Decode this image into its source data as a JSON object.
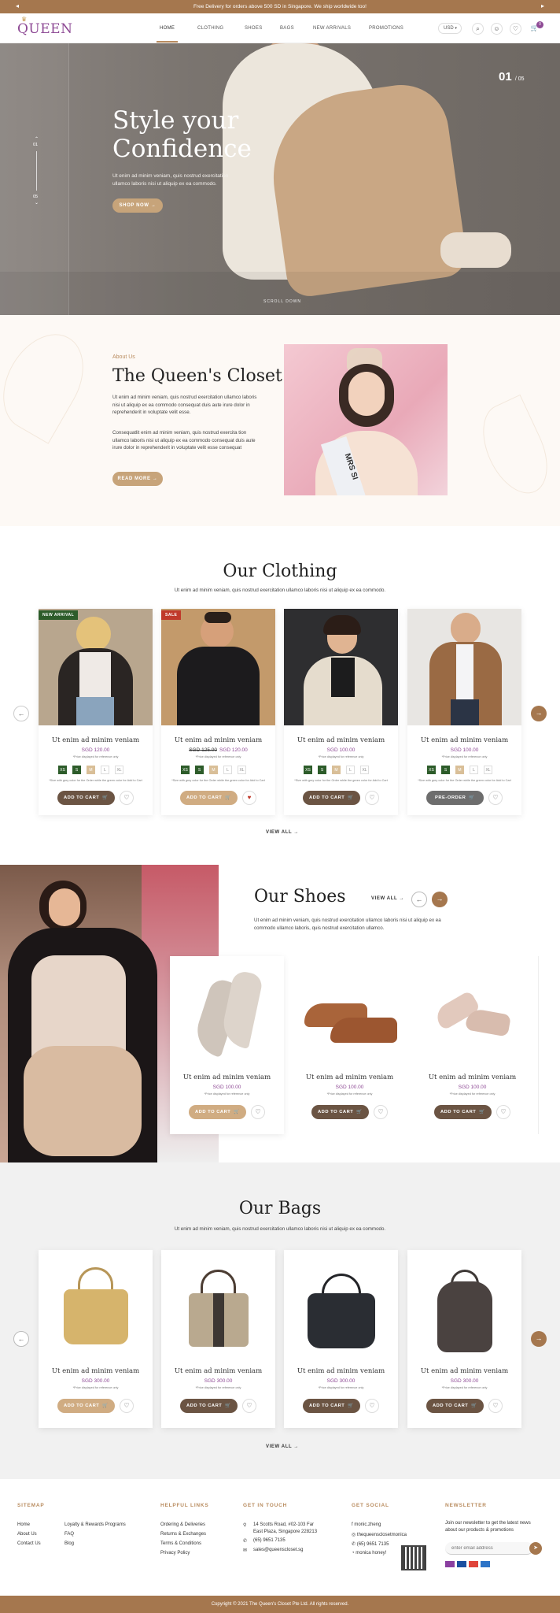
{
  "topbar": {
    "text": "Free Delivery for orders above 500 SD in Singapore. We ship worldwide too!",
    "prev": "◂",
    "next": "▸"
  },
  "brand": {
    "logo": "QUEEN",
    "accent": "#8e4a95",
    "gold": "#b98c5f",
    "brown": "#a5774e"
  },
  "nav": {
    "items": [
      "HOME",
      "CLOTHING",
      "SHOES",
      "BAGS",
      "NEW ARRIVALS",
      "PROMOTIONS"
    ],
    "currency": "USD",
    "cart_count": "0"
  },
  "hero": {
    "title_line1": "Style your",
    "title_line2": "Confidence",
    "subtitle": "Ut enim ad minim veniam, quis nostrud exercitation ullamco laboris nisi ut aliquip ex ea commodo.",
    "cta": "SHOP NOW",
    "counter_current": "01",
    "counter_total": "/ 05",
    "scroll_label": "SCROLL DOWN",
    "indicator_top": "01",
    "indicator_bottom": "05"
  },
  "about": {
    "label": "About Us",
    "title": "The Queen's Closet",
    "para1": "Ut enim ad minim veniam, quis nostrud exercitation ullamco laboris nisi ut aliquip ex ea commodo consequat duis aute irure dolor in reprehenderit in voluptate velit esse.",
    "para2": "Consequatlit enim ad minim veniam, quis nostrud exercita tion ullamco laboris nisi ut aliquip ex ea commodo consequat duis aute irure dolor in reprehenderit in voluptate velit esse consequat",
    "cta": "READ MORE",
    "sash_text": "MRS SI"
  },
  "clothing": {
    "title": "Our Clothing",
    "subtitle": "Ut enim ad minim veniam, quis nostrud exercitation ullamco laboris nisi ut aliquip ex ea commodo.",
    "view_all": "VIEW ALL",
    "sizes": [
      "XS",
      "S",
      "M",
      "L",
      "XL"
    ],
    "products": [
      {
        "badge": "NEW ARRIVAL",
        "name": "Ut enim ad minim veniam",
        "old_price": "",
        "price": "SGD 120.00",
        "note": "*Price displayed for reference only",
        "size_note": "*Size with grey color for the Order while the green color for Add to Cart",
        "cta": "ADD TO CART"
      },
      {
        "badge": "SALE",
        "name": "Ut enim ad minim veniam",
        "old_price": "SGD 125.00",
        "price": "SGD 120.00",
        "note": "*Price displayed for reference only",
        "size_note": "*Size with grey color for the Order while the green color for Add to Cart",
        "cta": "ADD TO CART"
      },
      {
        "badge": "",
        "name": "Ut enim ad minim veniam",
        "old_price": "",
        "price": "SGD 100.00",
        "note": "*Price displayed for reference only",
        "size_note": "*Size with grey color for the Order while the green color for Add to Cart",
        "cta": "ADD TO CART"
      },
      {
        "badge": "",
        "name": "Ut enim ad minim veniam",
        "old_price": "",
        "price": "SGD 100.00",
        "note": "*Price displayed for reference only",
        "size_note": "*Size with grey color for the Order while the green color for Add to Cart",
        "cta": "PRE-ORDER"
      }
    ]
  },
  "shoes": {
    "title": "Our Shoes",
    "view_all": "VIEW ALL",
    "subtitle": "Ut enim ad minim veniam, quis nostrud exercitation ullamco laboris nisi ut aliquip ex ea commodo ullamco laboris, quis nostrud exercitation ullamco.",
    "products": [
      {
        "name": "Ut enim ad minim veniam",
        "price": "SGD 100.00",
        "note": "*Price displayed for reference only",
        "cta": "ADD TO CART"
      },
      {
        "name": "Ut enim ad minim veniam",
        "price": "SGD 100.00",
        "note": "*Price displayed for reference only",
        "cta": "ADD TO CART"
      },
      {
        "name": "Ut enim ad minim veniam",
        "price": "SGD 100.00",
        "note": "*Price displayed for reference only",
        "cta": "ADD TO CART"
      }
    ]
  },
  "bags": {
    "title": "Our Bags",
    "subtitle": "Ut enim ad minim veniam, quis nostrud exercitation ullamco laboris nisi ut aliquip ex ea commodo.",
    "view_all": "VIEW ALL",
    "products": [
      {
        "name": "Ut enim ad minim veniam",
        "price": "SGD 300.00",
        "note": "*Price displayed for reference only",
        "cta": "ADD TO CART"
      },
      {
        "name": "Ut enim ad minim veniam",
        "price": "SGD 300.00",
        "note": "*Price displayed for reference only",
        "cta": "ADD TO CART"
      },
      {
        "name": "Ut enim ad minim veniam",
        "price": "SGD 300.00",
        "note": "*Price displayed for reference only",
        "cta": "ADD TO CART"
      },
      {
        "name": "Ut enim ad minim veniam",
        "price": "SGD 300.00",
        "note": "*Price displayed for reference only",
        "cta": "ADD TO CART"
      }
    ]
  },
  "footer": {
    "sitemap": {
      "title": "SITEMAP",
      "col1": [
        "Home",
        "About Us",
        "Contact Us"
      ],
      "col2": [
        "Loyalty & Rewards Programs",
        "FAQ",
        "Blog"
      ]
    },
    "helpful": {
      "title": "HELPFUL LINKS",
      "links": [
        "Ordering & Deliveries",
        "Returns & Exchanges",
        "Terms & Conditions",
        "Privacy Policy"
      ]
    },
    "contact": {
      "title": "GET IN TOUCH",
      "address1": "14 Scotts Road, #02-103 Far",
      "address2": "East Plaza, Singapore 228213",
      "phone": "(65) 9651 7135",
      "email": "sales@queenscloset.sg"
    },
    "social": {
      "title": "GET SOCIAL",
      "facebook": "monic.zheng",
      "instagram": "thequeensclosetmonica",
      "whatsapp": "(65) 9651 7135",
      "wechat": "monica honey!"
    },
    "newsletter": {
      "title": "NEWSLETTER",
      "text": "Join our newsletter to get the latest news about our products & promotions",
      "placeholder": "enter email address"
    },
    "copyright": "Copyright © 2021 The Queen's Closet Pte Ltd. All rights reserved."
  }
}
